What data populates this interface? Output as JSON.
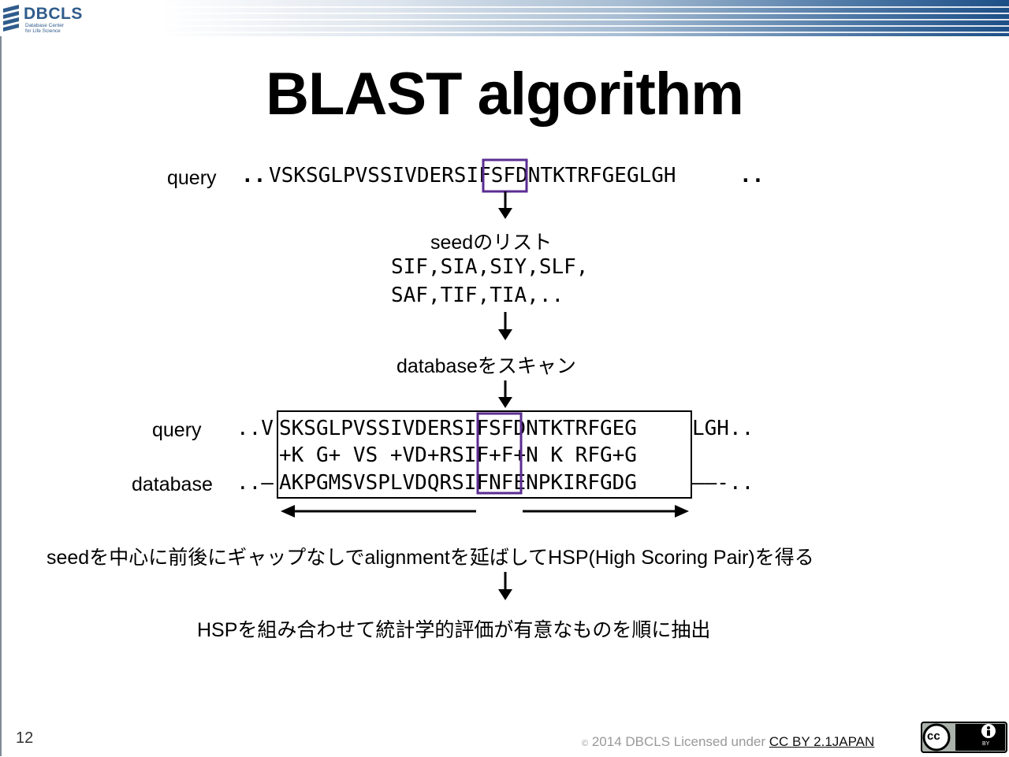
{
  "header": {
    "logo_text": "DBCLS",
    "logo_subtitle": "Database Center\nfor Life Science"
  },
  "title": "BLAST algorithm",
  "query_top": {
    "label": "query",
    "leading": "..",
    "sequence": "VSKSGLPVSSIVDERSIFSFDNTKTRFGEGLGH",
    "trailing": ".."
  },
  "seed_list": {
    "label": "seedのリスト",
    "lines": [
      "SIF,SIA,SIY,SLF,",
      "SAF,TIF,TIA,.."
    ]
  },
  "scan": {
    "label": "databaseをスキャン"
  },
  "alignment": {
    "query_label": "query",
    "query_leading": "..V",
    "query_seq": "SKSGLPVSSIVDERSIFSFDNTKTRFGEG",
    "query_trailing": "LGH..",
    "match_line": "+K G+ VS +VD+RSIF+F+N K RFG+G",
    "db_label": "database",
    "db_leading": "..–",
    "db_seq": "AKPGMSVSPLVDQRSIFNFENPKIRFGDG",
    "db_trailing": "——-.."
  },
  "extend_caption": "seedを中心に前後にギャップなしでalignmentを延ばしてHSP(High Scoring Pair)を得る",
  "final_caption": "HSPを組み合わせて統計学的評価が有意なものを順に抽出",
  "footer": {
    "page_number": "12",
    "copyright_symbol": "©",
    "copyright": " 2014 DBCLS Licensed under ",
    "license_link": "CC BY 2.1JAPAN",
    "badge_cc": "cc",
    "badge_by": "BY"
  },
  "colors": {
    "highlight": "#5b2d91",
    "logo": "#2f5c8c",
    "arrow": "#000000"
  }
}
